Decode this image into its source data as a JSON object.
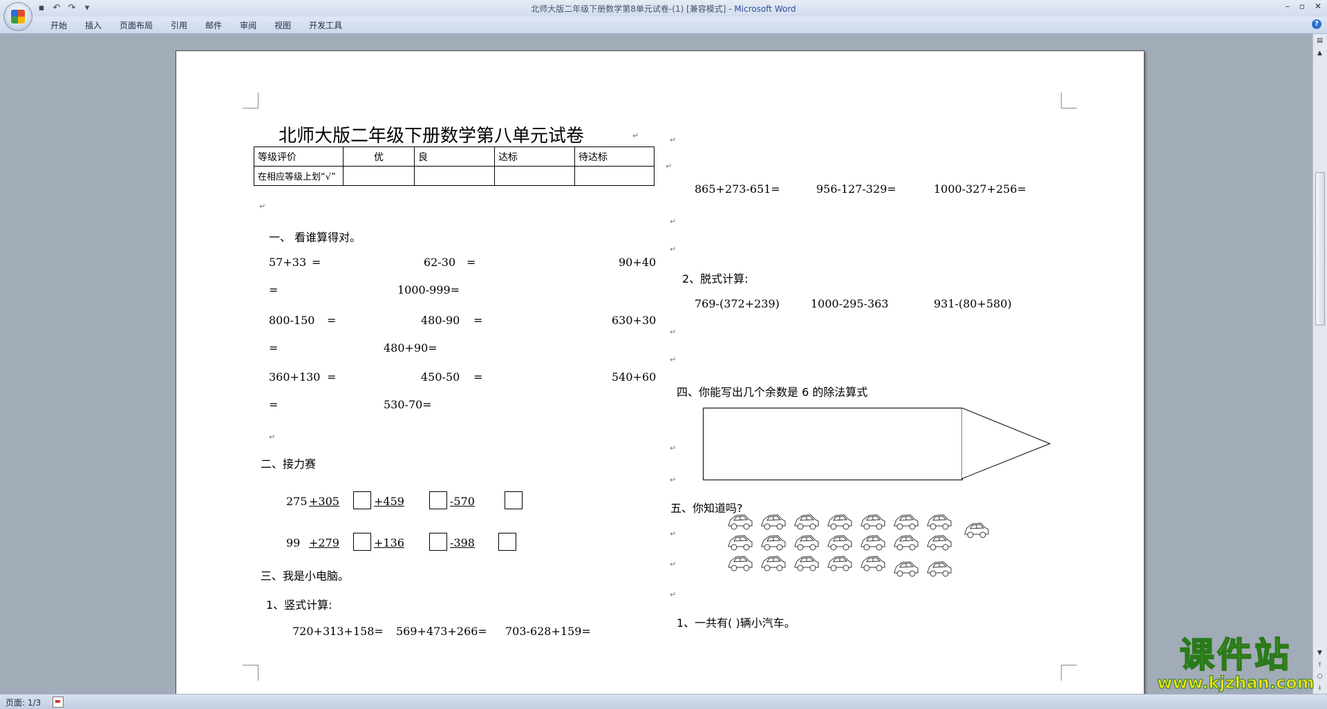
{
  "window": {
    "title_doc": "北师大版二年级下册数学第8单元试卷-(1) [兼容模式] - ",
    "title_app": "Microsoft Word"
  },
  "ribbon": {
    "tabs": [
      "开始",
      "插入",
      "页面布局",
      "引用",
      "邮件",
      "审阅",
      "视图",
      "开发工具"
    ]
  },
  "document": {
    "title": "北师大版二年级下册数学第八单元试卷",
    "grade_table": {
      "row1": [
        "等级评价",
        "优",
        "良",
        "达标",
        "待达标"
      ],
      "row2_label": "在相应等级上划“√”"
    },
    "sec1": {
      "heading": "一、  看谁算得对。",
      "row1": [
        "57+33",
        "=",
        "62-30",
        "=",
        "90+40"
      ],
      "row2": [
        "=",
        "1000-999="
      ],
      "row3": [
        "800-150",
        "=",
        "480-90",
        "=",
        "630+30"
      ],
      "row4": [
        "=",
        "480+90="
      ],
      "row5": [
        "360+130",
        "=",
        "450-50",
        "=",
        "540+60"
      ],
      "row6": [
        "=",
        "530-70="
      ]
    },
    "sec2": {
      "heading": "二、接力赛",
      "chain1": [
        "275",
        "+305",
        "+459",
        "-570"
      ],
      "chain2": [
        "99",
        "+279",
        "+136",
        "-398"
      ]
    },
    "sec3": {
      "heading": "三、我是小电脑。",
      "sub1": "1、竖式计算:",
      "sub1_items": [
        "720+313+158=",
        "569+473+266=",
        "703-628+159="
      ],
      "right_items": [
        "865+273-651=",
        "956-127-329=",
        "1000-327+256="
      ],
      "sub2": "2、脱式计算:",
      "sub2_items": [
        "769-(372+239)",
        "1000-295-363",
        "931-(80+580)"
      ]
    },
    "sec4": {
      "heading": "四、你能写出几个余数是 6 的除法算式"
    },
    "sec5": {
      "heading": "五、你知道吗?",
      "q1": "1、一共有(    )辆小汽车。",
      "car_rows": [
        8,
        7,
        7
      ]
    }
  },
  "status": {
    "page": "页面: 1/3"
  },
  "watermark": {
    "big": "课件站",
    "small": "www.kjzhan.com"
  },
  "colors": {
    "title_app": "#2c4f9e",
    "watermark_fill": "#f0e21a",
    "watermark_stroke": "#2a7a1a"
  }
}
